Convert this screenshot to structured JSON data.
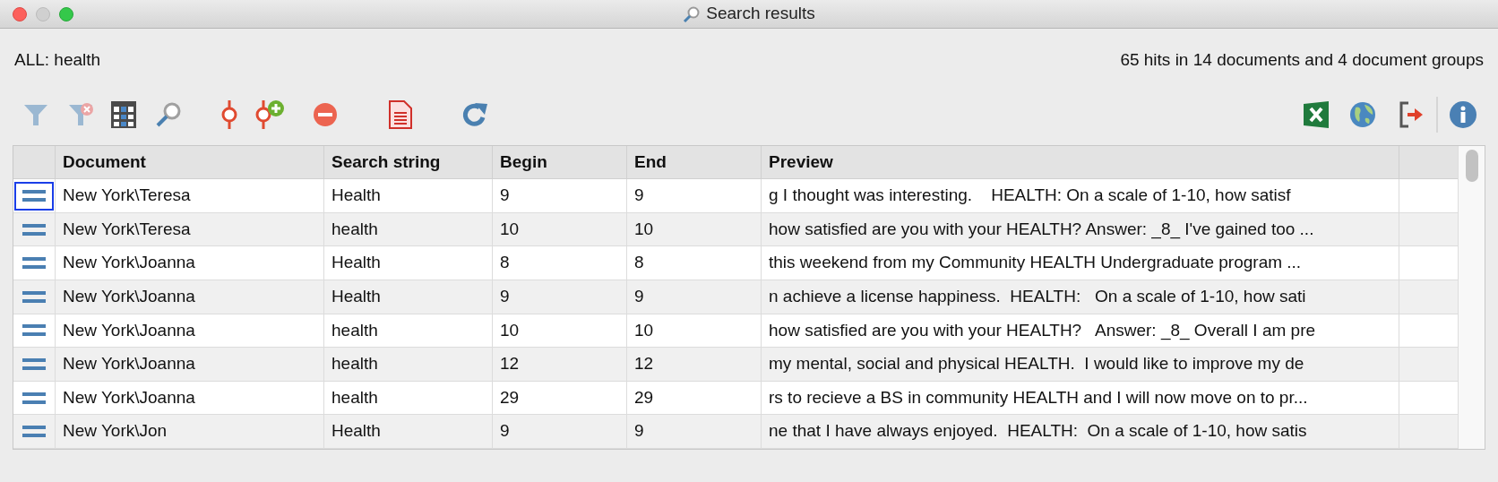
{
  "window": {
    "title": "Search results"
  },
  "query": "ALL: health",
  "summary": "65 hits in 14 documents and 4 document groups",
  "table": {
    "columns": [
      "Document",
      "Search string",
      "Begin",
      "End",
      "Preview"
    ],
    "rows": [
      {
        "selected": true,
        "cells": [
          "New York\\Teresa",
          "Health",
          "9",
          "9",
          "g I thought was interesting.    HEALTH: On a scale of 1-10, how satisf"
        ]
      },
      {
        "selected": false,
        "cells": [
          "New York\\Teresa",
          "health",
          "10",
          "10",
          "how satisfied are you with your HEALTH? Answer: _8_ I've gained too ..."
        ]
      },
      {
        "selected": false,
        "cells": [
          "New York\\Joanna",
          "Health",
          "8",
          "8",
          "this weekend from my Community HEALTH Undergraduate program ..."
        ]
      },
      {
        "selected": false,
        "cells": [
          "New York\\Joanna",
          "Health",
          "9",
          "9",
          "n achieve a license happiness.  HEALTH:   On a scale of 1-10, how sati"
        ]
      },
      {
        "selected": false,
        "cells": [
          "New York\\Joanna",
          "health",
          "10",
          "10",
          "how satisfied are you with your HEALTH?   Answer: _8_ Overall I am pre"
        ]
      },
      {
        "selected": false,
        "cells": [
          "New York\\Joanna",
          "health",
          "12",
          "12",
          "my mental, social and physical HEALTH.  I would like to improve my de"
        ]
      },
      {
        "selected": false,
        "cells": [
          "New York\\Joanna",
          "health",
          "29",
          "29",
          "rs to recieve a BS in community HEALTH and I will now move on to pr..."
        ]
      },
      {
        "selected": false,
        "cells": [
          "New York\\Jon",
          "Health",
          "9",
          "9",
          "ne that I have always enjoyed.  HEALTH:  On a scale of 1-10, how satis"
        ]
      }
    ]
  }
}
